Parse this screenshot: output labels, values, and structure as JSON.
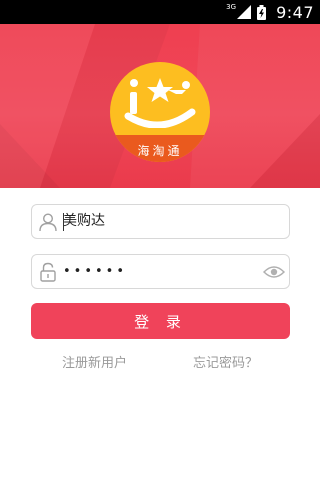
{
  "status_bar": {
    "network": "3G",
    "time": "9:47"
  },
  "logo": {
    "text": "海淘通"
  },
  "form": {
    "username_value": "美购达",
    "password_masked": "••••••",
    "login_label": "登 录",
    "register_label": "注册新用户",
    "forgot_label": "忘记密码？"
  },
  "colors": {
    "header_red": "#ef3f50",
    "button_red": "#f0435a",
    "logo_yellow": "#fdbe20",
    "logo_orange": "#ea5a1e",
    "link_gray": "#9a9a9a",
    "icon_gray": "#a0a0a0"
  },
  "icons": {
    "username": "user-icon",
    "password": "lock-icon",
    "show_password": "eye-icon",
    "signal": "signal-icon",
    "battery": "battery-icon"
  }
}
